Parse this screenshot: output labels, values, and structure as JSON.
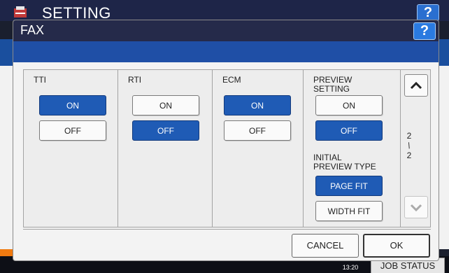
{
  "background": {
    "title": "SETTING",
    "help_label": "?",
    "clock": "13:20",
    "job_status_label": "JOB STATUS"
  },
  "dialog": {
    "title": "FAX",
    "help_label": "?",
    "columns": {
      "tti": {
        "label": "TTI",
        "on_label": "ON",
        "off_label": "OFF",
        "selected": "ON"
      },
      "rti": {
        "label": "RTI",
        "on_label": "ON",
        "off_label": "OFF",
        "selected": "OFF"
      },
      "ecm": {
        "label": "ECM",
        "on_label": "ON",
        "off_label": "OFF",
        "selected": "ON"
      },
      "preview": {
        "label_line1": "PREVIEW",
        "label_line2": "SETTING",
        "on_label": "ON",
        "off_label": "OFF",
        "selected": "OFF",
        "type_label_line1": "INITIAL",
        "type_label_line2": "PREVIEW TYPE",
        "page_fit_label": "PAGE FIT",
        "width_fit_label": "WIDTH FIT",
        "type_selected": "PAGE FIT"
      }
    },
    "pagination": {
      "current": "2",
      "separator": "/",
      "total": "2"
    },
    "cancel_label": "CANCEL",
    "ok_label": "OK"
  }
}
